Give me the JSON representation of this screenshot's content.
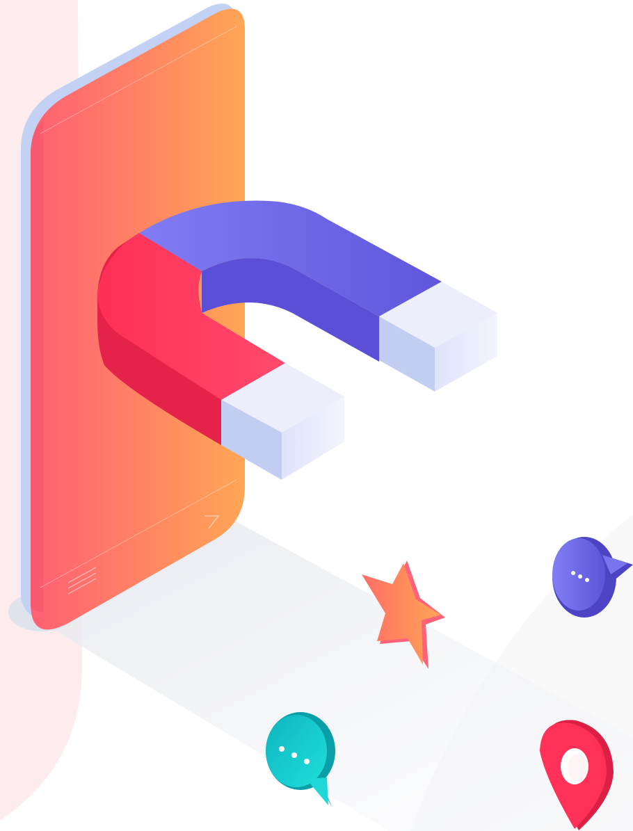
{
  "illustration": {
    "subject": "magnet-attracting-icons-from-smartphone",
    "colors": {
      "backdrop_blush": "#fdeced",
      "phone_gradient_start": "#ff5f73",
      "phone_gradient_end": "#ffa655",
      "phone_edge": "#c3d2f4",
      "magnet_red": "#ff3158",
      "magnet_red_shadow": "#e5224a",
      "magnet_blue": "#7a74ee",
      "magnet_blue_shadow": "#5a4fd6",
      "pole_tip": "#e6e8fb",
      "pole_tip_shade": "#c1cdf1",
      "star_orange": "#ff8a5c",
      "chat_teal": "#11c5cc",
      "chat_purple": "#7a74ee",
      "pin_red": "#ff3158"
    },
    "icons": [
      "smartphone-icon",
      "magnet-icon",
      "star-icon",
      "chat-bubble-icon",
      "map-pin-icon"
    ]
  }
}
